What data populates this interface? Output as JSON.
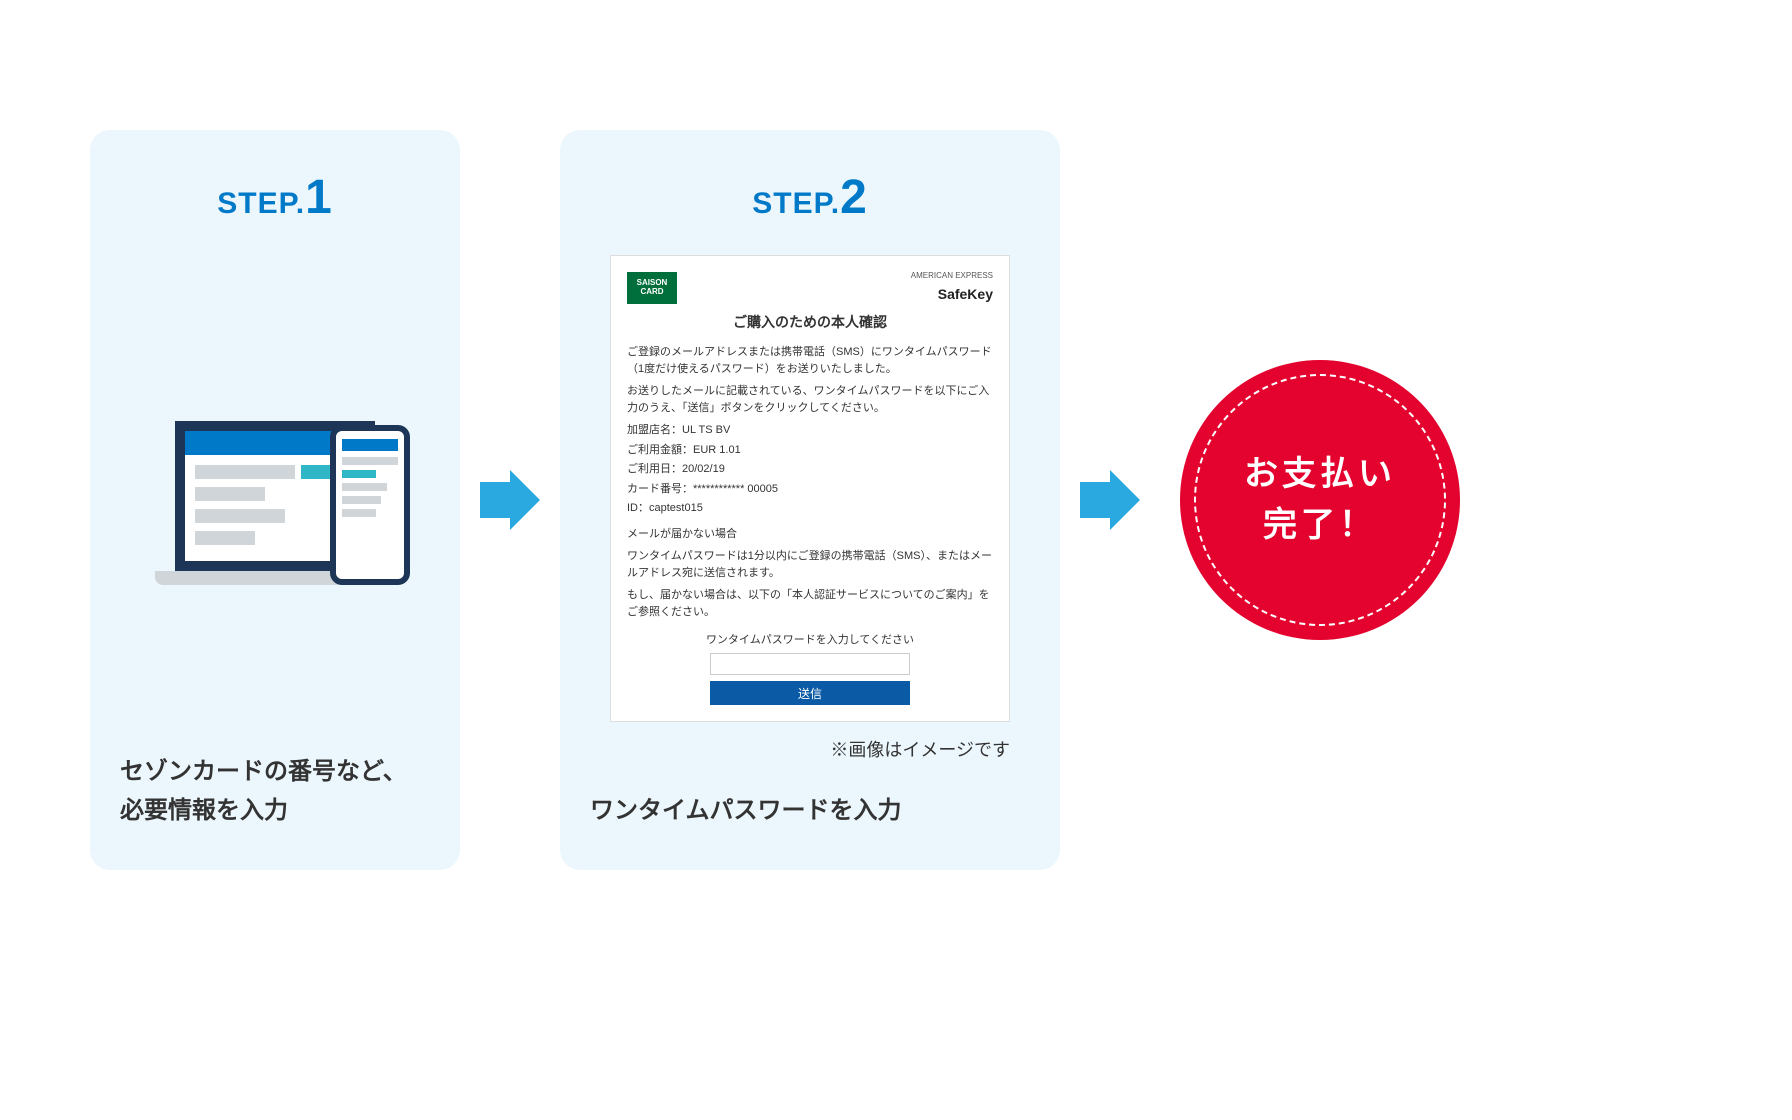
{
  "step1": {
    "label": "STEP.",
    "num": "1",
    "desc": "セゾンカードの番号など、\n必要情報を入力"
  },
  "step2": {
    "label": "STEP.",
    "num": "2",
    "desc": "ワンタイムパスワードを入力",
    "note": "※画像はイメージです"
  },
  "panel": {
    "saison1": "SAISON",
    "saison2": "CARD",
    "amex": "AMERICAN EXPRESS",
    "safekey": "SafeKey",
    "title": "ご購入のための本人確認",
    "p1": "ご登録のメールアドレスまたは携帯電話（SMS）にワンタイムパスワード（1度だけ使えるパスワード）をお送りいたしました。",
    "p2": "お送りしたメールに記載されている、ワンタイムパスワードを以下にご入力のうえ、「送信」ボタンをクリックしてください。",
    "merchant": "加盟店名：UL TS BV",
    "amount": "ご利用金額：EUR 1.01",
    "date": "ご利用日：20/02/19",
    "card": "カード番号：************ 00005",
    "id": "ID：captest015",
    "nomail_h": "メールが届かない場合",
    "nomail1": "ワンタイムパスワードは1分以内にご登録の携帯電話（SMS）、またはメールアドレス宛に送信されます。",
    "nomail2": "もし、届かない場合は、以下の「本人認証サービスについてのご案内」をご参照ください。",
    "otp_label": "ワンタイムパスワードを入力してください",
    "send": "送信"
  },
  "badge": {
    "l1": "お支払い",
    "l2": "完了！"
  }
}
